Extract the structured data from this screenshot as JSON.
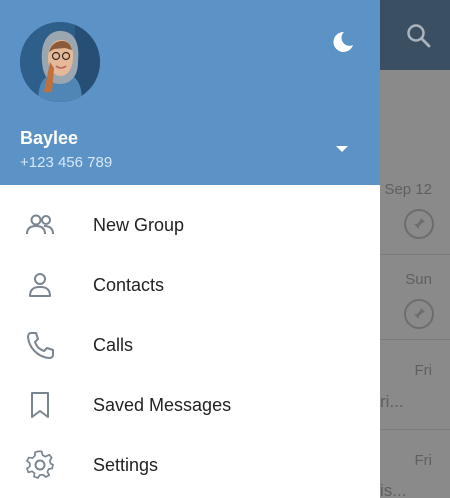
{
  "profile": {
    "name": "Baylee",
    "phone": "+123 456 789"
  },
  "menu": {
    "items": [
      {
        "label": "New Group",
        "icon": "new-group-icon"
      },
      {
        "label": "Contacts",
        "icon": "contacts-icon"
      },
      {
        "label": "Calls",
        "icon": "calls-icon"
      },
      {
        "label": "Saved Messages",
        "icon": "saved-messages-icon"
      },
      {
        "label": "Settings",
        "icon": "settings-icon"
      }
    ]
  },
  "chat_list": {
    "rows": [
      {
        "date": "Sep 12",
        "pinned": true,
        "snippet": ""
      },
      {
        "date": "Sun",
        "pinned": true,
        "snippet": ""
      },
      {
        "date": "Fri",
        "pinned": false,
        "snippet": "ri..."
      },
      {
        "date": "Fri",
        "pinned": false,
        "snippet": "is..."
      }
    ]
  },
  "colors": {
    "header": "#5b93c7",
    "toolbar": "#3b4f63",
    "icon": "#7a8590"
  }
}
